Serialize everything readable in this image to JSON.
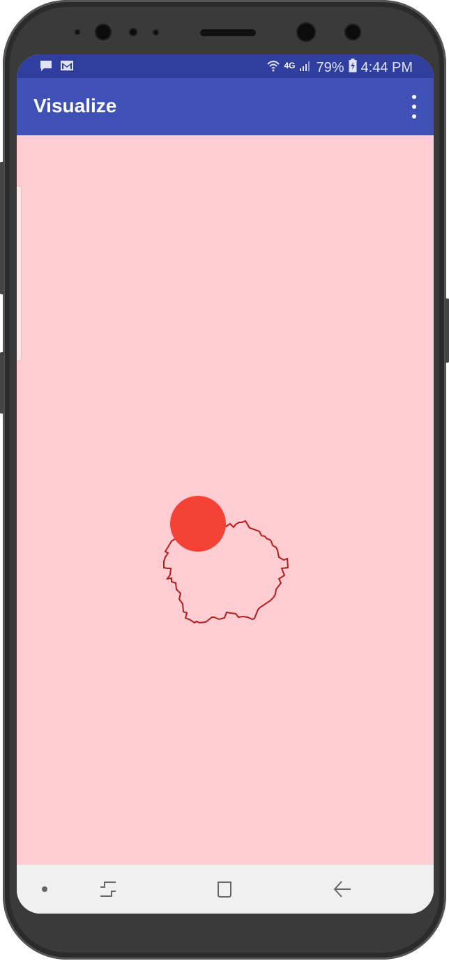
{
  "status_bar": {
    "network": "4G",
    "battery": "79%",
    "time": "4:44 PM",
    "left_icons": [
      "message-icon",
      "gmail-icon"
    ],
    "right_icons": [
      "wifi-icon",
      "lte-icon",
      "signal-icon",
      "battery-charging-icon"
    ]
  },
  "app_bar": {
    "title": "Visualize",
    "menu_icon": "overflow-menu-icon"
  },
  "visualizer": {
    "background_color": "#ffcdd2",
    "outline_color": "#b71c1c",
    "circle_color": "#f44336"
  },
  "nav_bar": {
    "items": [
      "home-dot-icon",
      "recents-icon",
      "home-square-icon",
      "back-icon"
    ]
  },
  "colors": {
    "status_bar": "#303f9f",
    "app_bar": "#3f51b5",
    "nav_bar": "#f0f0f0"
  }
}
